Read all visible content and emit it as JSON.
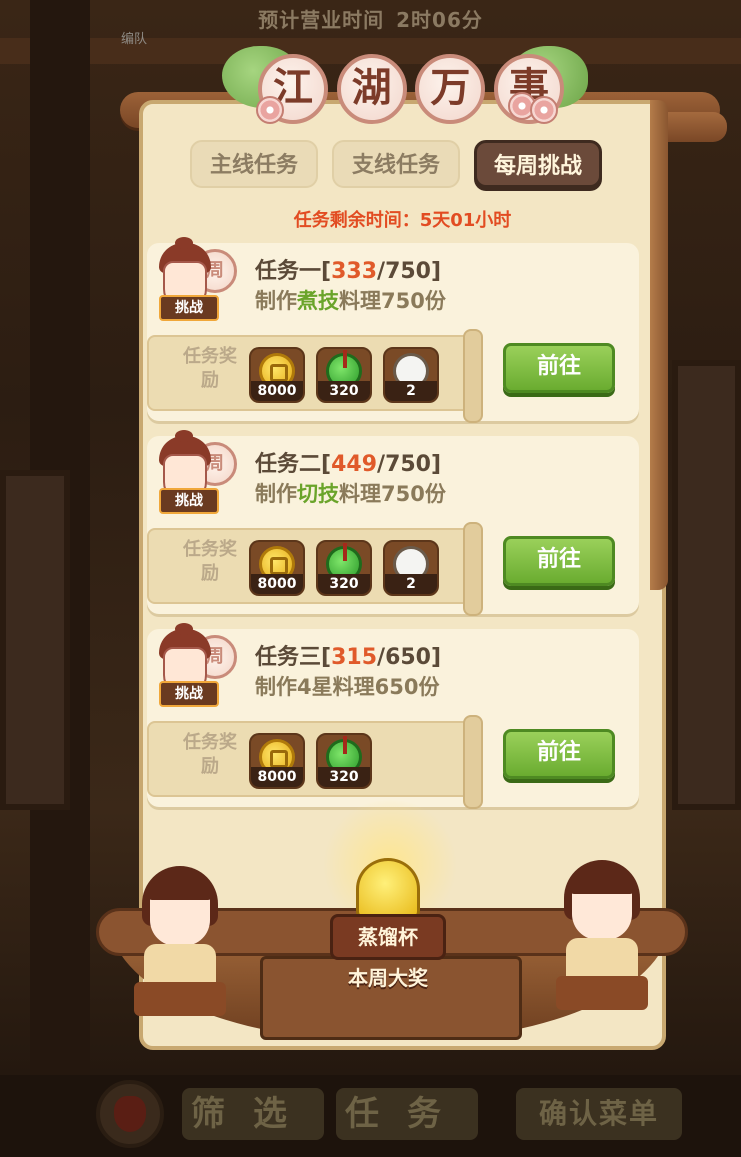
{
  "header": {
    "timer_label": "预计营业时间",
    "timer_value": "2时06分",
    "team_label": "编队"
  },
  "panel": {
    "title_chars": [
      "江",
      "湖",
      "万",
      "事"
    ],
    "tabs": [
      {
        "label": "主线任务",
        "active": false
      },
      {
        "label": "支线任务",
        "active": false
      },
      {
        "label": "每周挑战",
        "active": true
      }
    ],
    "remaining_label": "任务剩余时间：",
    "remaining_value": "5天01小时"
  },
  "tasks": [
    {
      "name": "任务一",
      "current": "333",
      "total": "750",
      "desc_prefix": "制作",
      "desc_keyword": "煮技",
      "desc_suffix": "料理750份",
      "badge_char": "周",
      "badge_tag": "挑战",
      "reward_label": "任务奖励",
      "rewards": [
        {
          "icon": "copper-coin-icon",
          "count": "8000"
        },
        {
          "icon": "jade-icon",
          "count": "320"
        },
        {
          "icon": "rice-ball-icon",
          "count": "2"
        }
      ],
      "button": "前往"
    },
    {
      "name": "任务二",
      "current": "449",
      "total": "750",
      "desc_prefix": "制作",
      "desc_keyword": "切技",
      "desc_suffix": "料理750份",
      "badge_char": "周",
      "badge_tag": "挑战",
      "reward_label": "任务奖励",
      "rewards": [
        {
          "icon": "copper-coin-icon",
          "count": "8000"
        },
        {
          "icon": "jade-icon",
          "count": "320"
        },
        {
          "icon": "rice-ball-icon",
          "count": "2"
        }
      ],
      "button": "前往"
    },
    {
      "name": "任务三",
      "current": "315",
      "total": "650",
      "desc_prefix": "制作",
      "desc_keyword": "",
      "desc_suffix": "4星料理650份",
      "badge_char": "周",
      "badge_tag": "挑战",
      "reward_label": "任务奖励",
      "rewards": [
        {
          "icon": "copper-coin-icon",
          "count": "8000"
        },
        {
          "icon": "jade-icon",
          "count": "320"
        }
      ],
      "button": "前往"
    }
  ],
  "prize": {
    "name": "蒸馏杯",
    "subtitle": "本周大奖"
  },
  "bottom": {
    "filter_label": "筛选",
    "task_label": "任务",
    "confirm_label": "确认菜单"
  },
  "colors": {
    "accent_red": "#e24c22",
    "progress_orange": "#e05a2a",
    "keyword_green": "#6aa42a",
    "go_button_green": "#6aac30"
  }
}
